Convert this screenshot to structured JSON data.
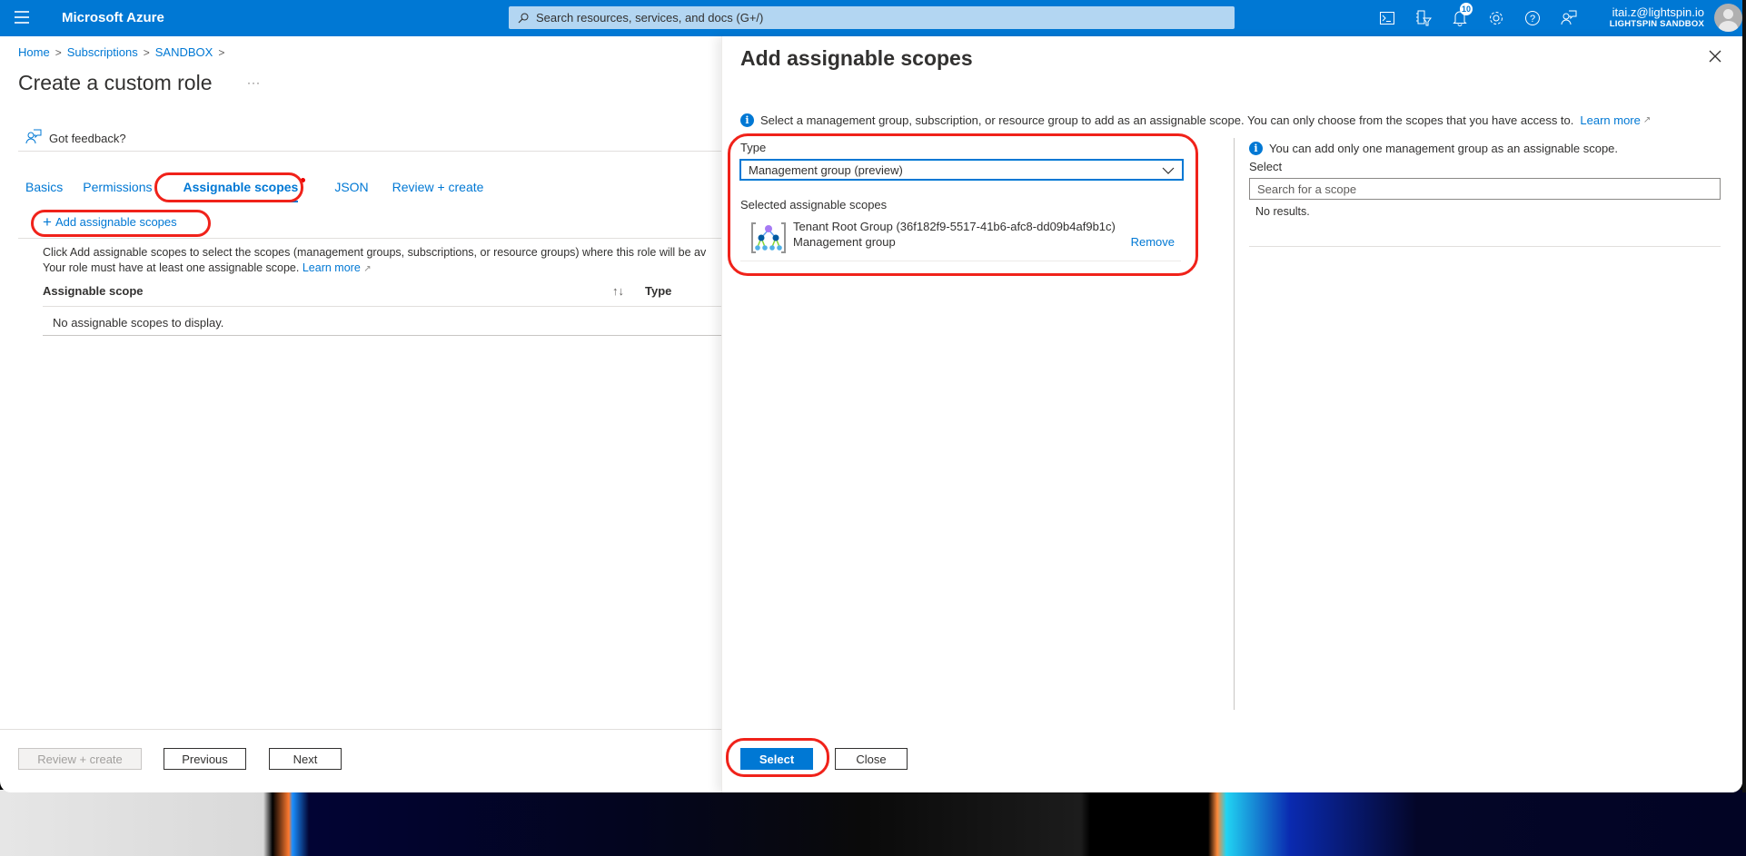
{
  "topbar": {
    "brand": "Microsoft Azure",
    "search_placeholder": "Search resources, services, and docs (G+/)",
    "notification_count": "10",
    "account_email": "itai.z@lightspin.io",
    "account_tenant": "LIGHTSPIN SANDBOX",
    "icons": [
      "cloud-shell-icon",
      "directory-filter-icon",
      "notifications-icon",
      "settings-icon",
      "help-icon",
      "feedback-icon"
    ]
  },
  "breadcrumb": [
    "Home",
    "Subscriptions",
    "SANDBOX"
  ],
  "page": {
    "title": "Create a custom role",
    "more": "···",
    "feedback": "Got feedback?",
    "tabs": [
      {
        "label": "Basics",
        "active": false
      },
      {
        "label": "Permissions",
        "active": false
      },
      {
        "label": "Assignable scopes",
        "active": true,
        "has_error_dot": true
      },
      {
        "label": "JSON",
        "active": false
      },
      {
        "label": "Review + create",
        "active": false
      }
    ],
    "add_scopes_label": "Add assignable scopes",
    "description_line1": "Click Add assignable scopes to select the scopes (management groups, subscriptions, or resource groups) where this role will be av",
    "description_line2": "Your role must have at least one assignable scope.",
    "learn_more": "Learn more",
    "table": {
      "columns": [
        "Assignable scope",
        "Type"
      ],
      "sort_glyph": "↑↓",
      "empty_message": "No assignable scopes to display."
    },
    "footer": {
      "review_create": "Review + create",
      "previous": "Previous",
      "next": "Next"
    }
  },
  "panel": {
    "title": "Add assignable scopes",
    "info": "Select a management group, subscription, or resource group to add as an assignable scope. You can only choose from the scopes that you have access to.",
    "learn_more": "Learn more",
    "type_label": "Type",
    "type_value": "Management group (preview)",
    "selected_label": "Selected assignable scopes",
    "selected_scopes": [
      {
        "name": "Tenant Root Group (36f182f9-5517-41b6-afc8-dd09b4af9b1c)",
        "type": "Management group",
        "action": "Remove"
      }
    ],
    "right": {
      "info": "You can add only one management group as an assignable scope.",
      "select_label": "Select",
      "search_placeholder": "Search for a scope",
      "no_results": "No results."
    },
    "footer": {
      "select": "Select",
      "close": "Close"
    }
  },
  "colors": {
    "brand_blue": "#0078d4",
    "annotation_red": "#f0221a"
  }
}
